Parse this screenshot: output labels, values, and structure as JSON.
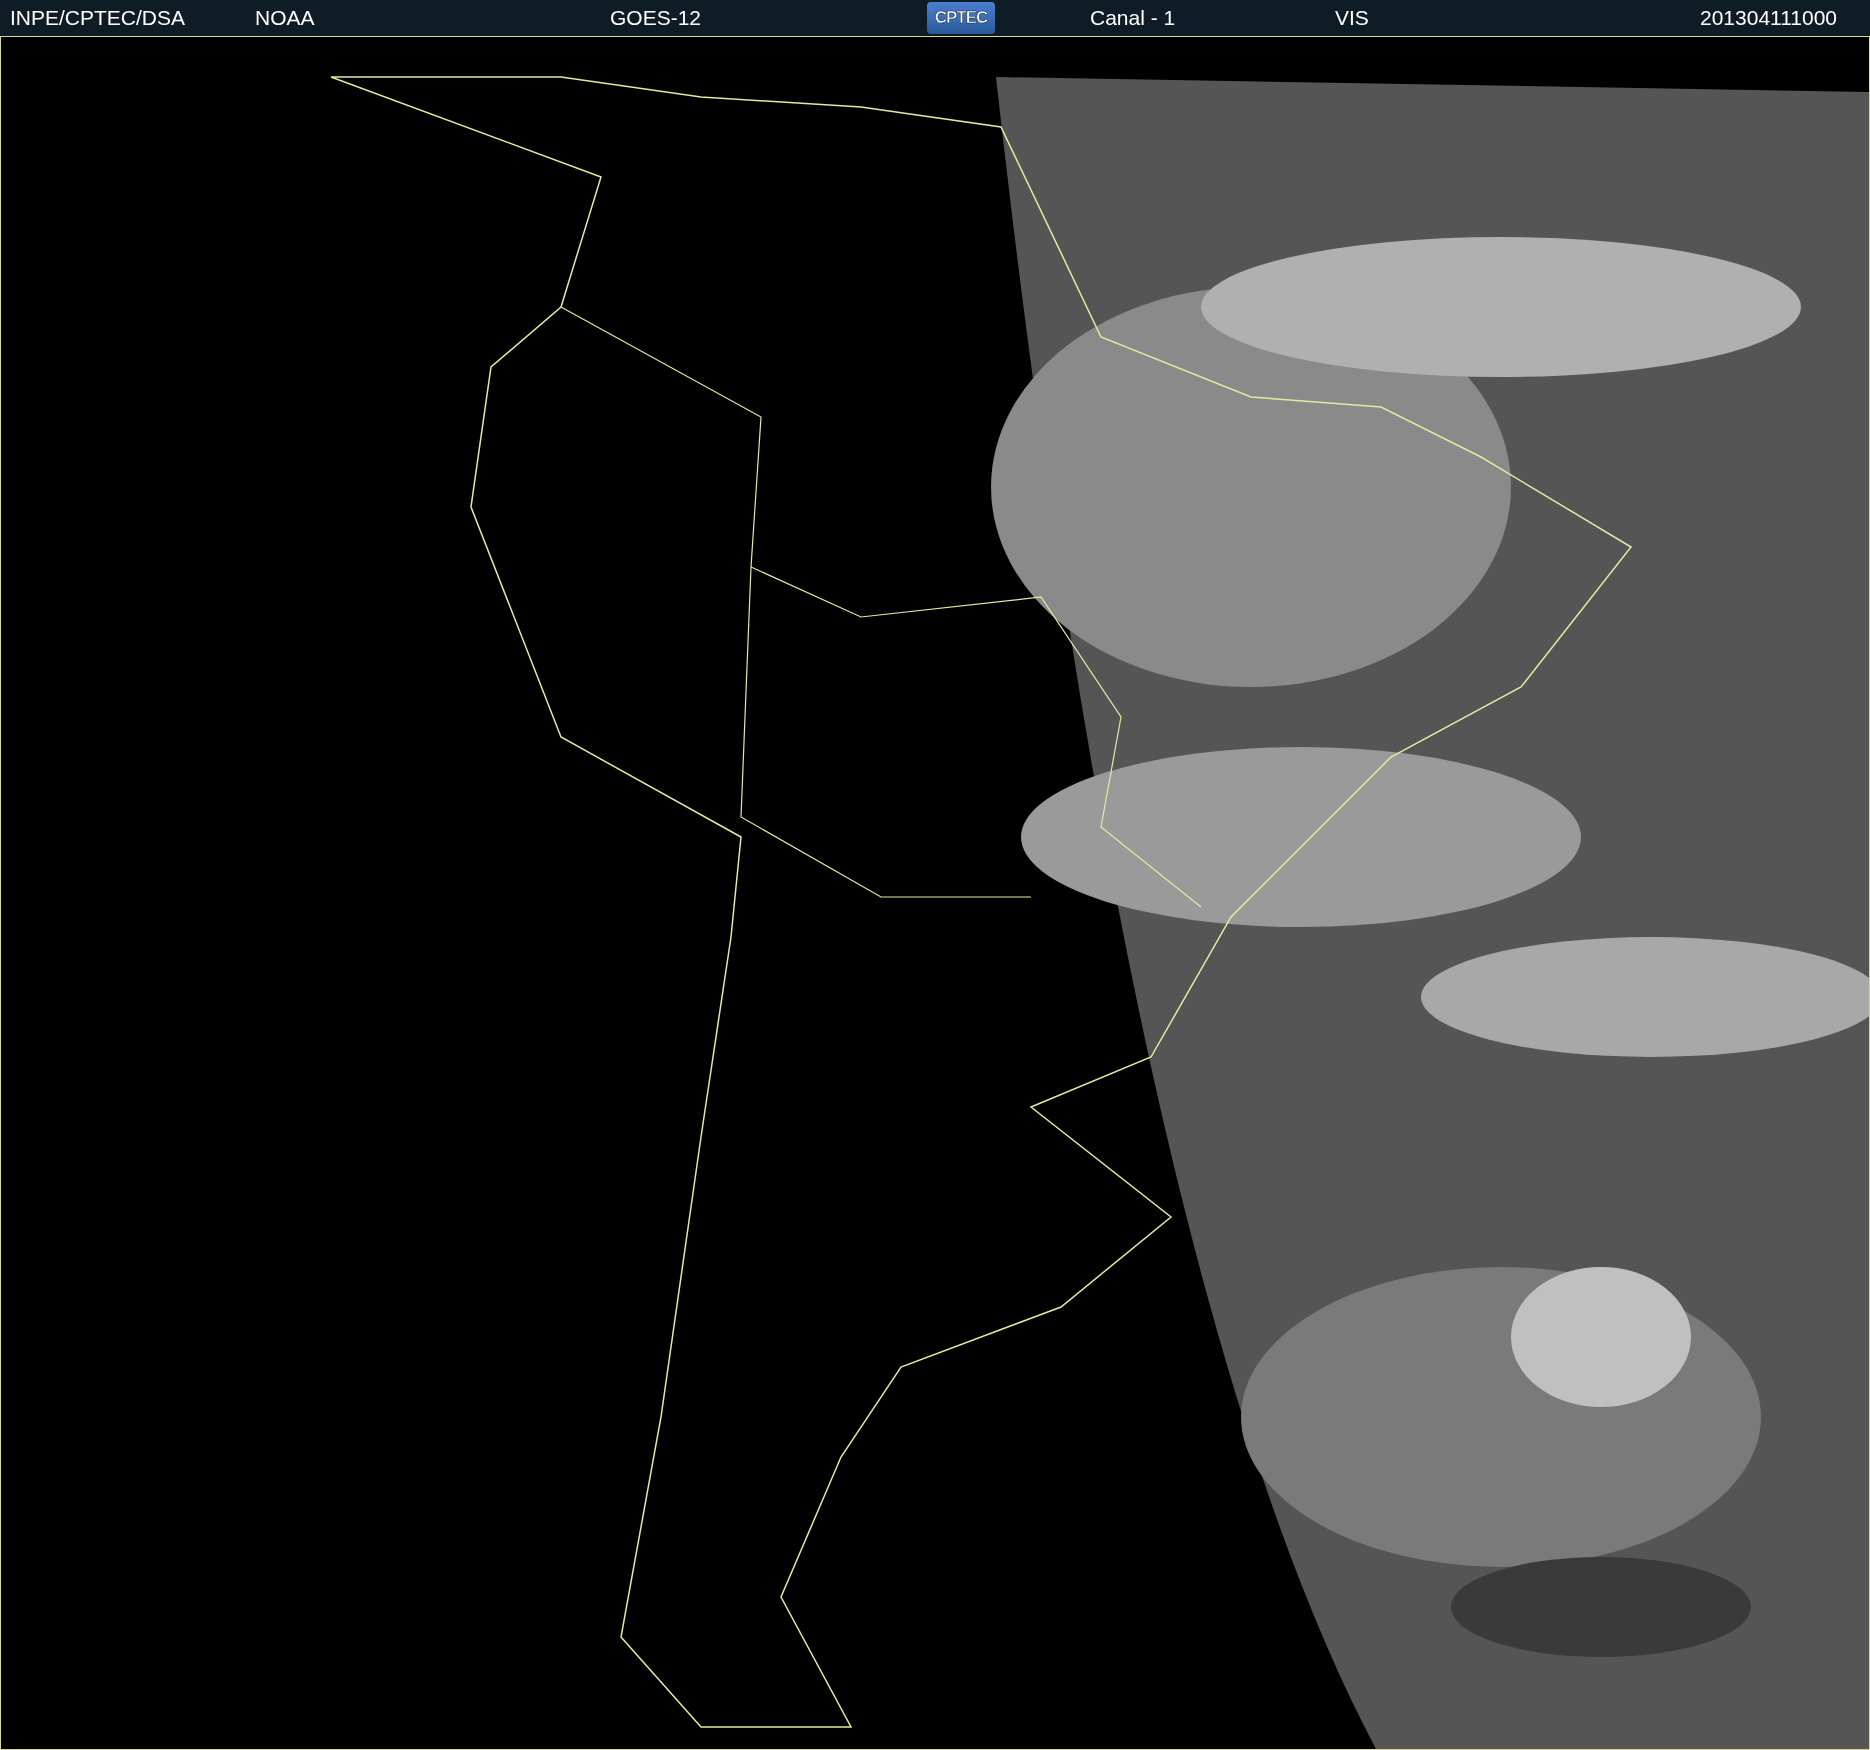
{
  "header": {
    "source": "INPE/CPTEC/DSA",
    "agency": "NOAA",
    "satellite": "GOES-12",
    "logo": "CPTEC",
    "channel": "Canal - 1",
    "band": "VIS",
    "timestamp": "201304111000"
  }
}
